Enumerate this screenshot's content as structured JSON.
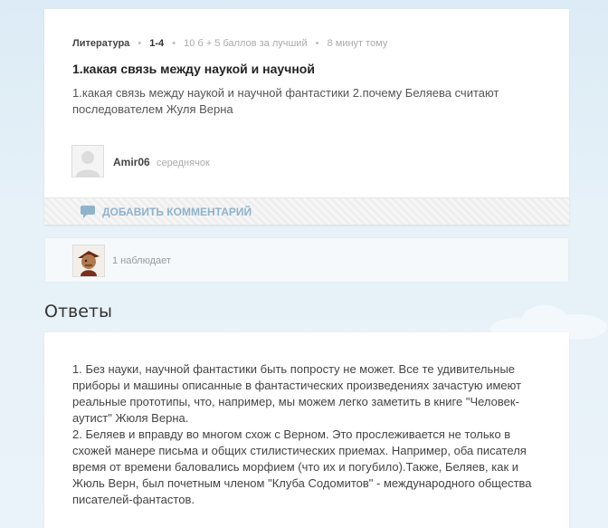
{
  "question": {
    "subject": "Литература",
    "grade": "1-4",
    "points": "10 б + 5 баллов за лучший",
    "time": "8 минут тому",
    "title": "1.какая связь между наукой и научной",
    "text": "1.какая связь между наукой и научной фантастики 2.почему Беляева считают последователем Жуля Верна",
    "author": {
      "nick": "Amir06",
      "rank": "середнячок"
    },
    "comment_button": "ДОБАВИТЬ КОММЕНТАРИЙ"
  },
  "watchers": {
    "text": "1 наблюдает"
  },
  "answers": {
    "heading": "Ответы",
    "items": [
      {
        "paragraphs": [
          "1. Без науки, научной фантастики быть попросту не может. Все те удивительные приборы и машины описанные в фантастических произведениях зачастую имеют реальные прототипы, что, например, мы можем легко заметить  в книге \"Человек-аутист\" Жюля Верна.",
          "2. Беляев и вправду во многом схож с Верном. Это прослеживается не только в схожей манере письма и общих стилистических приемах. Например, оба писателя время от времени баловались морфием (что их и погубило).Также, Беляев, как и Жюль Верн, был почетным членом \"Клуба Содомитов\" - международного  общества писателей-фантастов."
        ]
      }
    ]
  },
  "colors": {
    "accent": "#8fb3cc",
    "background": "#e6f1f8"
  },
  "icons": {
    "comment": "speech-bubble-icon",
    "default_avatar": "user-silhouette-icon"
  }
}
